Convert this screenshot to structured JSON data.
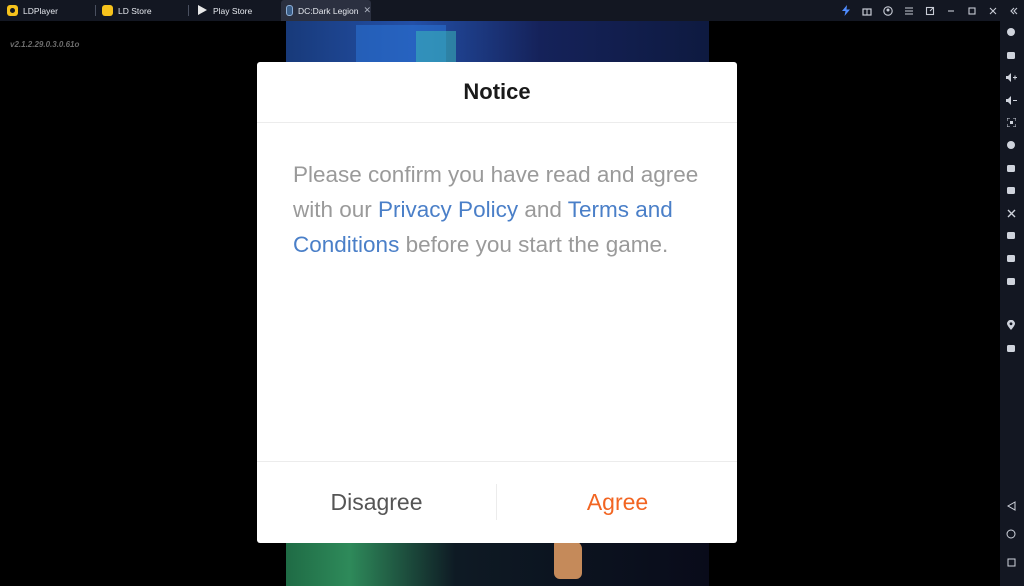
{
  "tabs": [
    {
      "label": "LDPlayer",
      "icon": "ldplayer-icon"
    },
    {
      "label": "LD Store",
      "icon": "ld-store-icon"
    },
    {
      "label": "Play Store",
      "icon": "play-store-icon"
    },
    {
      "label": "DC:Dark Legion",
      "icon": "game-icon",
      "active": true,
      "close": "✕"
    }
  ],
  "window_controls": [
    "bolt-icon",
    "gift-icon",
    "account-icon",
    "menu-icon",
    "popout-icon",
    "minimize-icon",
    "maximize-icon",
    "close-icon",
    "collapse-sidebar-icon"
  ],
  "version": "v2.1.2.29.0.3.0.61o",
  "dialog": {
    "title": "Notice",
    "body_prefix": "Please confirm you have read and agree with our ",
    "privacy_link": "Privacy Policy",
    "body_mid": " and ",
    "terms_link": "Terms and Conditions",
    "body_suffix": " before you start the game.",
    "disagree_label": "Disagree",
    "agree_label": "Agree"
  },
  "sidebar_tools": [
    "keyboard-mapping-icon",
    "keyboard-icon",
    "volume-up-icon",
    "volume-down-icon",
    "screenshot-icon",
    "install-apk-icon",
    "multi-instance-icon",
    "robot-icon",
    "operation-record-icon",
    "video-record-icon",
    "sync-icon",
    "folder-icon",
    "location-icon",
    "more-icon"
  ],
  "nav_buttons": [
    "back-icon",
    "home-icon",
    "recents-icon"
  ],
  "colors": {
    "accent_agree": "#f26522",
    "link": "#4a7fc8",
    "chrome": "#131722"
  }
}
